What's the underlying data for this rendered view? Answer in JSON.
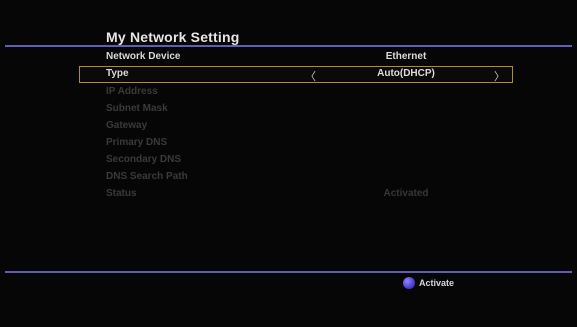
{
  "screen": {
    "title": "My Network Setting"
  },
  "rows": [
    {
      "label": "Network Device",
      "value": "Ethernet"
    },
    {
      "label": "Type",
      "value": "Auto(DHCP)",
      "left_arrow": "〈",
      "right_arrow": "〉"
    },
    {
      "label": "IP Address",
      "value": ""
    },
    {
      "label": "Subnet Mask",
      "value": ""
    },
    {
      "label": "Gateway",
      "value": ""
    },
    {
      "label": "Primary DNS",
      "value": ""
    },
    {
      "label": "Secondary DNS",
      "value": ""
    },
    {
      "label": "DNS Search Path",
      "value": ""
    },
    {
      "label": "Status",
      "value": "Activated"
    }
  ],
  "footer": {
    "action_label": "Activate",
    "action_button_color": "blue",
    "action_icon": "blue-dot-icon"
  },
  "colors": {
    "accent_line": "#5e5fb3",
    "selection_border": "#b48a32",
    "button_blue": "#4b3fd0"
  }
}
